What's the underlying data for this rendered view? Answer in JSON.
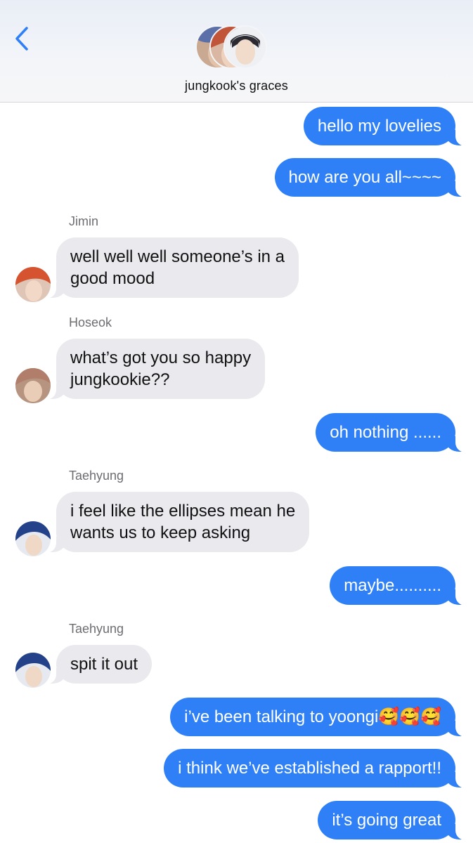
{
  "header": {
    "back_icon": "chevron-left-icon",
    "group_name": "jungkook's graces",
    "accent": "#2f80f7"
  },
  "messages": [
    {
      "dir": "out",
      "text": "hello my lovelies"
    },
    {
      "dir": "out",
      "text": "how are you all~~~~"
    },
    {
      "dir": "in",
      "sender": "Jimin",
      "lines": [
        "well well well someone’s in a",
        "good mood"
      ]
    },
    {
      "dir": "in",
      "sender": "Hoseok",
      "lines": [
        "what’s got you so happy",
        "jungkookie??"
      ]
    },
    {
      "dir": "out",
      "text": "oh nothing ......"
    },
    {
      "dir": "in",
      "sender": "Taehyung",
      "lines": [
        "i feel like the ellipses mean he",
        "wants us to keep asking"
      ]
    },
    {
      "dir": "out",
      "text": "maybe.........."
    },
    {
      "dir": "in",
      "sender": "Taehyung",
      "lines": [
        "spit it out"
      ]
    },
    {
      "dir": "out",
      "text": "i’ve been talking to yoongi🥰🥰🥰"
    },
    {
      "dir": "out",
      "text": "i think we’ve established a rapport!!"
    },
    {
      "dir": "out",
      "text": "it’s going great"
    }
  ]
}
